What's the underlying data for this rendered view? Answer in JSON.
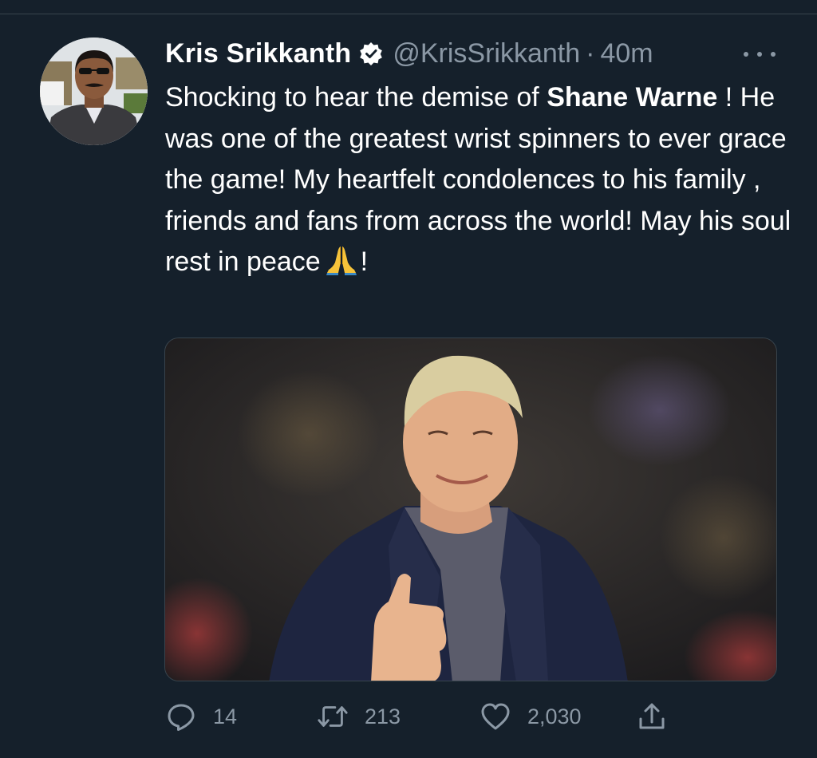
{
  "tweet": {
    "author": {
      "display_name": "Kris Srikkanth",
      "handle": "@KrisSrikkanth",
      "verified": true,
      "avatar_icon": "profile-photo"
    },
    "separator": "·",
    "time": "40m",
    "text": {
      "part1": "Shocking to hear the demise of ",
      "bold_name": "Shane Warne",
      "part2": " ! He was one of the greatest wrist spinners to ever grace the game! My heartfelt condolences to his family , friends and fans from across the world! May his soul rest in peace",
      "emoji_icon": "folded-hands-emoji",
      "part3": "!"
    },
    "media": {
      "icon": "photo-thumbs-up-man"
    },
    "actions": {
      "replies": {
        "icon": "reply-icon",
        "count": "14"
      },
      "retweets": {
        "icon": "retweet-icon",
        "count": "213"
      },
      "likes": {
        "icon": "like-icon",
        "count": "2,030"
      },
      "share": {
        "icon": "share-icon"
      }
    }
  },
  "colors": {
    "background": "#15202b",
    "text_primary": "#ffffff",
    "text_secondary": "#8b98a5",
    "divider": "#38444d"
  }
}
